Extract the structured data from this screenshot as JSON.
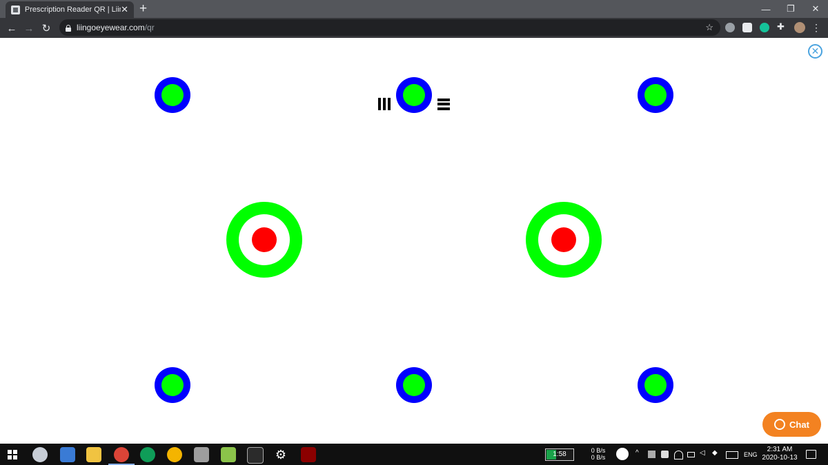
{
  "browser": {
    "tab_title": "Prescription Reader QR | Liingo E",
    "tab_close": "✕",
    "new_tab": "+",
    "url_host": "liingoeyewear.com",
    "url_path": "/qr",
    "window_controls": {
      "minimize": "—",
      "restore": "❐",
      "close": "✕"
    },
    "nav": {
      "back": "←",
      "forward": "→",
      "reload": "↻"
    },
    "star": "☆",
    "menu": "⋮"
  },
  "page": {
    "close_icon": "✕",
    "chat_label": "Chat",
    "colors": {
      "small_target_outer": "#0000ff",
      "small_target_inner": "#00ff00",
      "big_target_ring": "#00ff00",
      "big_target_center": "#ff0000",
      "chat_button": "#f38221"
    }
  },
  "taskbar": {
    "battery_timer": "1:58",
    "net_up": "0 B/s",
    "net_down": "0 B/s",
    "language": "ENG",
    "time": "2:31 AM",
    "date": "2020-10-13"
  }
}
